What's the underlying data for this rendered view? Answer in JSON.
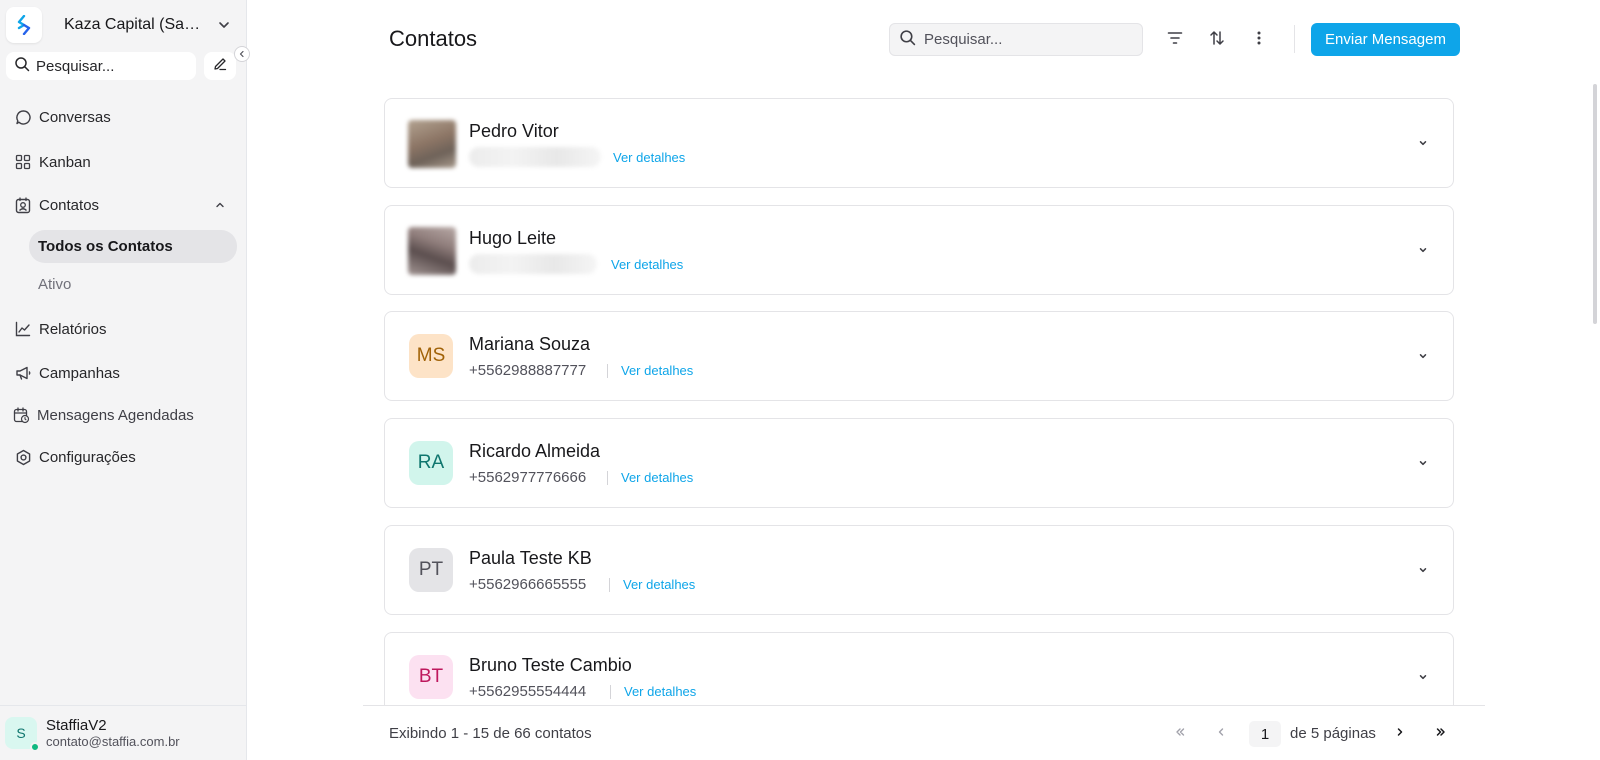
{
  "sidebar": {
    "workspace_name": "Kaza Capital (San...",
    "search_placeholder": "Pesquisar...",
    "nav": [
      {
        "label": "Conversas",
        "icon": "chat-icon"
      },
      {
        "label": "Kanban",
        "icon": "kanban-icon"
      },
      {
        "label": "Contatos",
        "icon": "contacts-icon"
      },
      {
        "label": "Relatórios",
        "icon": "chart-icon"
      },
      {
        "label": "Campanhas",
        "icon": "megaphone-icon"
      },
      {
        "label": "Mensagens Agendadas",
        "icon": "calendar-clock-icon"
      },
      {
        "label": "Configurações",
        "icon": "gear-icon"
      }
    ],
    "contatos_sub": [
      {
        "label": "Todos os Contatos",
        "active": true
      },
      {
        "label": "Ativo",
        "active": false
      }
    ],
    "user": {
      "initial": "S",
      "name": "StaffiaV2",
      "email": "contato@staffia.com.br",
      "status_color": "#10b981"
    }
  },
  "header": {
    "title": "Contatos",
    "search_placeholder": "Pesquisar...",
    "send_button": "Enviar Mensagem",
    "accent_color": "#0ea5e9"
  },
  "contacts": [
    {
      "name": "Pedro Vitor",
      "phone": "",
      "initials": "",
      "link": "Ver detalhes"
    },
    {
      "name": "Hugo Leite",
      "phone": "",
      "initials": "",
      "link": "Ver detalhes"
    },
    {
      "name": "Mariana Souza",
      "phone": "+5562988887777",
      "initials": "MS",
      "link": "Ver detalhes"
    },
    {
      "name": "Ricardo Almeida",
      "phone": "+5562977776666",
      "initials": "RA",
      "link": "Ver detalhes"
    },
    {
      "name": "Paula Teste KB",
      "phone": "+5562966665555",
      "initials": "PT",
      "link": "Ver detalhes"
    },
    {
      "name": "Bruno Teste Cambio",
      "phone": "+5562955554444",
      "initials": "BT",
      "link": "Ver detalhes"
    }
  ],
  "footer": {
    "info": "Exibindo 1 - 15 de 66 contatos",
    "current_page": "1",
    "total_pages": "de 5 páginas"
  }
}
